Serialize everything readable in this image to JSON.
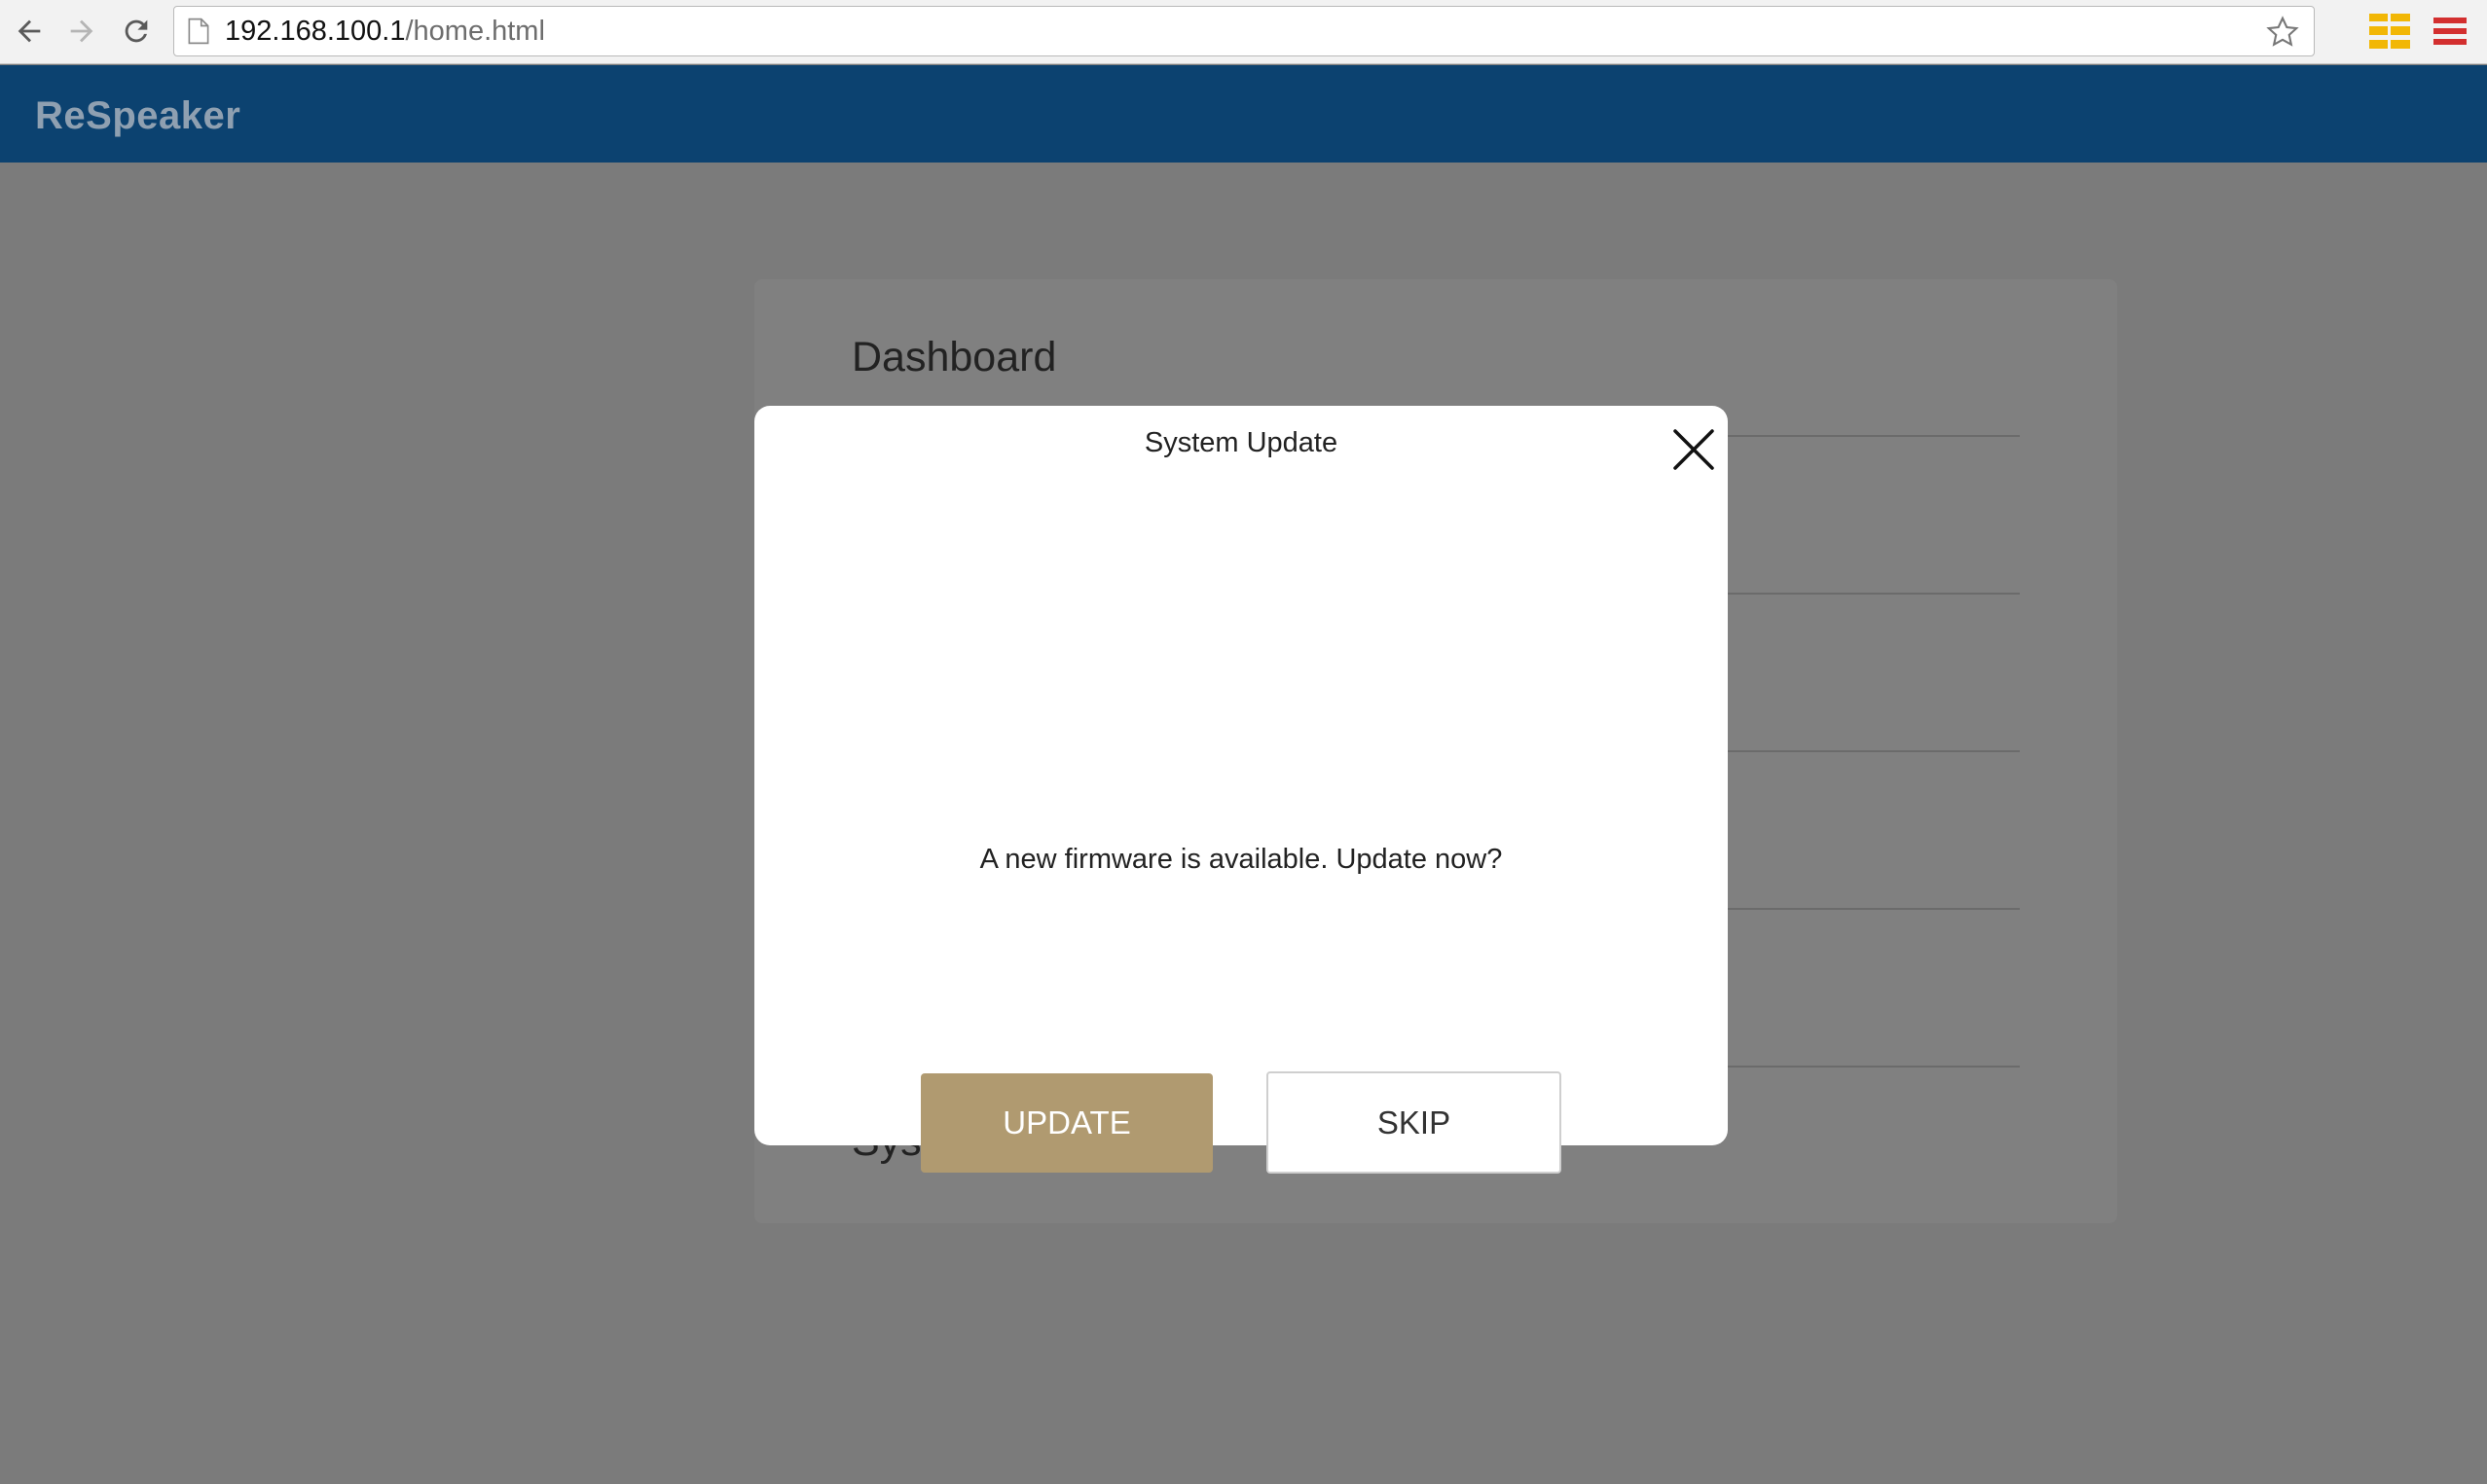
{
  "browser": {
    "url_host": "192.168.100.1",
    "url_path": "/home.html",
    "icons": {
      "back": "back-arrow-icon",
      "forward": "forward-arrow-icon",
      "reload": "reload-icon",
      "page": "page-icon",
      "bookmark": "star-icon",
      "extension": "extension-icon",
      "menu": "hamburger-menu-icon"
    }
  },
  "app": {
    "brand": "ReSpeaker",
    "header_color": "#0c4270"
  },
  "page": {
    "title": "Dashboard",
    "bottom_section_label": "Sys"
  },
  "modal": {
    "title": "System Update",
    "message": "A new firmware is available. Update now?",
    "update_label": "UPDATE",
    "skip_label": "SKIP",
    "update_color": "#b09a70"
  }
}
